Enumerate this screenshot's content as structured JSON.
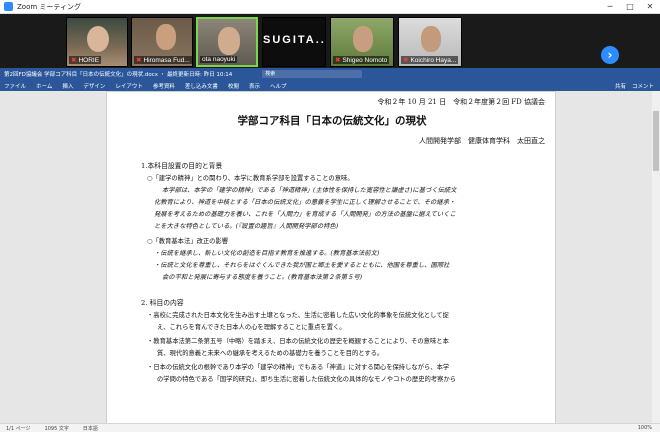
{
  "zoom": {
    "title": "Zoom ミーティング",
    "participants": [
      {
        "name": "HORIE"
      },
      {
        "name": "Hiromasa Fud..."
      },
      {
        "name": "ota naoyuki"
      },
      {
        "name": "SUGITA..."
      },
      {
        "name": "Shigeo Nomoto"
      },
      {
        "name": "Koichiro Haya..."
      }
    ]
  },
  "word": {
    "title": "第2回FD協議会 学部コア科目「日本の伝統文化」の現状.docx ・ 最終更新日時: 昨日 10:14",
    "search_placeholder": "検索",
    "tabs": [
      "ファイル",
      "ホーム",
      "挿入",
      "デザイン",
      "レイアウト",
      "参考資料",
      "差し込み文書",
      "校閲",
      "表示",
      "ヘルプ"
    ],
    "share": "共有",
    "comments": "コメント",
    "status": {
      "page": "1/1 ページ",
      "words": "1095 文字",
      "lang": "日本語",
      "zoom": "100%"
    }
  },
  "doc": {
    "date_line": "令和２年 10 月 21 日　令和２年度第２回 FD 協議会",
    "title": "学部コア科目「日本の伝統文化」の現状",
    "author": "人間開発学部　健康体育学科　太田直之",
    "s1": "1.本科目設置の目的と背景",
    "p1": "○「建学の精神」との関わり、本学に教育系学部を設置することの意味。",
    "p1a": "本学部は、本学の「建学の精神」である「神道精神」(主体性を保持した寛容性と謙虚さ)に基づく伝統文",
    "p1b": "化教育により、神道を中核とする「日本の伝統文化」の意義を学生に正しく理解させることで、その継承・",
    "p1c": "発展を考えるための基礎力を養い、これを「人間力」を育成する「人間開発」の方法の基盤に据えていくこ",
    "p1d": "とを大きな特色としている。(『設置の趣旨』人間開発学部の特色)",
    "p2": "○「教育基本法」改正の影響",
    "p2a": "・伝統を継承し、新しい文化の創造を目指す教育を推進する。(教育基本法前文)",
    "p2b": "・伝統と文化を尊重し、それらをはぐくんできた我が国と郷土を愛するとともに、他国を尊重し、国際社",
    "p2c": "会の平和と発展に寄与する態度を養うこと。(教育基本法第２条第５号)",
    "s2": "2. 科目の内容",
    "q1a": "・高校に完成された日本文化を生み出す土壌となった、生活に密着した広い文化的事象を伝統文化として捉",
    "q1b": "え、これらを育んできた日本人の心を理解することに重点を置く。",
    "q2a": "・教育基本法第二条第五号（中略）を踏まえ、日本の伝統文化の歴史を概観することにより、その意味と本",
    "q2b": "質、現代的意義と未来への継承を考えるための基礎力を養うことを目的とする。",
    "q3a": "・日本の伝統文化の根幹であり本学の「建学の精神」でもある「神道」に対する関心を保持しながら、本学",
    "q3b": "の学問の特色である「国学的研究」、即ち生活に密着した伝統文化の具体的なモノやコトの歴史的考察から"
  }
}
